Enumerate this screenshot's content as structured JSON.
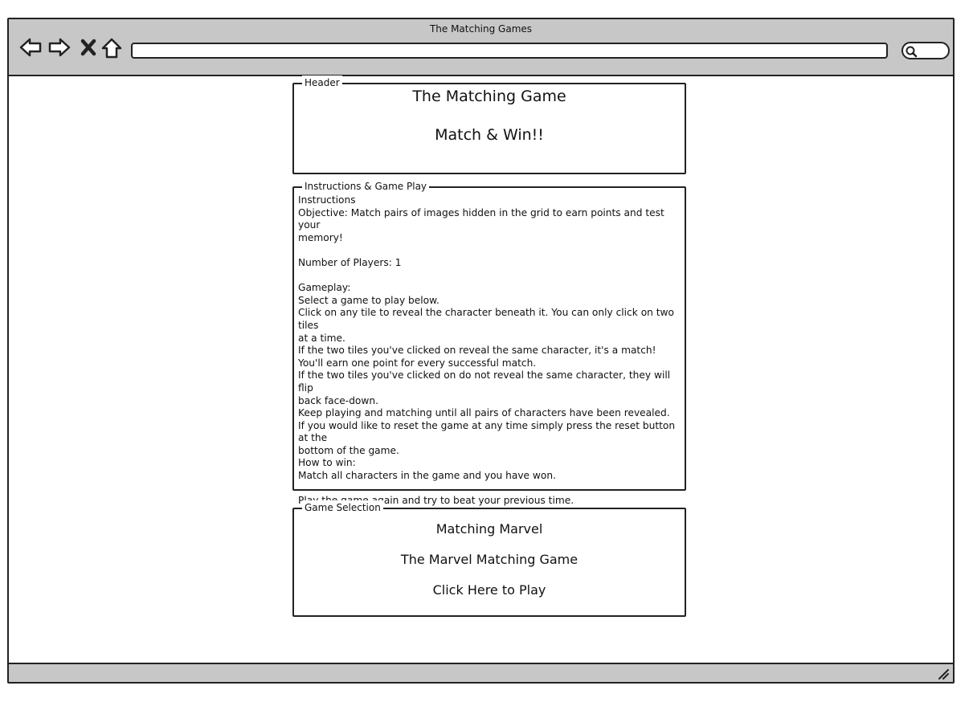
{
  "window": {
    "title": "The Matching Games"
  },
  "header_panel": {
    "legend": "Header",
    "title": "The Matching Game",
    "subtitle": "Match & Win!!"
  },
  "instructions_panel": {
    "legend": "Instructions & Game Play",
    "lines": [
      "Instructions",
      "Objective: Match pairs of images hidden in the grid to earn points and test your",
      "memory!",
      "",
      "Number of Players: 1",
      "",
      "Gameplay:",
      "Select a game to play below.",
      "Click on any tile to reveal the character beneath it. You can only click on two tiles",
      "at a time.",
      "If the two tiles you've clicked on reveal the same character, it's a match!",
      "You'll earn one point for every successful match.",
      "If the two tiles you've clicked on do not reveal the same character, they will flip",
      "back face-down.",
      "Keep playing and matching until all pairs of characters have been revealed.",
      "If you would like to reset the game at any time simply press the reset button at the",
      "bottom of the game.",
      "How to win:",
      "Match all characters in the game and you have won.",
      "",
      "Play the game again and try to beat your previous time."
    ]
  },
  "selection_panel": {
    "legend": "Game Selection",
    "game_name": "Matching Marvel",
    "game_description": "The Marvel Matching Game",
    "play_link": "Click Here to Play"
  },
  "icons": {
    "back": "back-arrow-icon",
    "forward": "forward-arrow-icon",
    "stop": "close-icon",
    "home": "home-icon",
    "search": "search-icon",
    "resize": "resize-grip-icon"
  }
}
